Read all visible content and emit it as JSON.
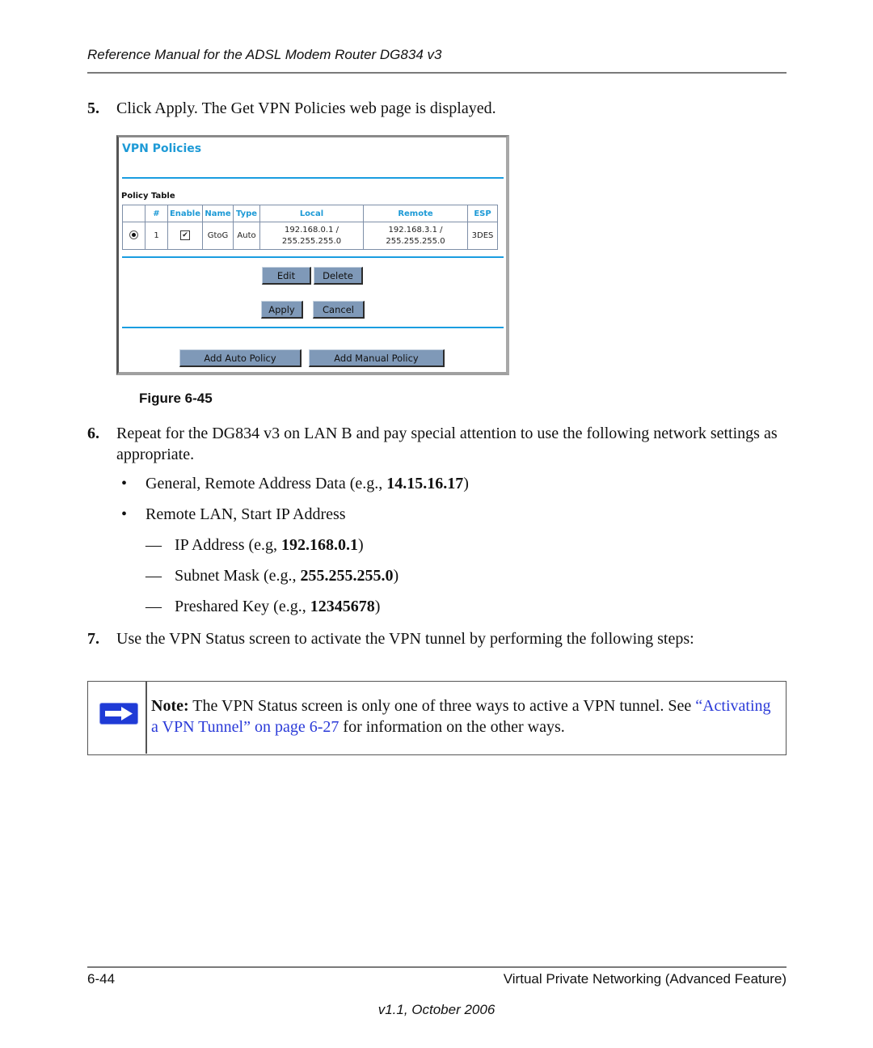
{
  "header": {
    "running_title": "Reference Manual for the ADSL Modem Router DG834 v3"
  },
  "step5": {
    "number": "5.",
    "text": "Click Apply. The Get VPN Policies web page is displayed."
  },
  "screenshot": {
    "title": "VPN Policies",
    "table_label": "Policy Table",
    "columns": [
      "",
      "#",
      "Enable",
      "Name",
      "Type",
      "Local",
      "Remote",
      "ESP"
    ],
    "rows": [
      {
        "selected": true,
        "num": "1",
        "enabled": true,
        "name": "GtoG",
        "type": "Auto",
        "local_ip": "192.168.0.1 /",
        "local_mask": "255.255.255.0",
        "remote_ip": "192.168.3.1 /",
        "remote_mask": "255.255.255.0",
        "esp": "3DES"
      }
    ],
    "buttons": {
      "edit": "Edit",
      "delete": "Delete",
      "apply": "Apply",
      "cancel": "Cancel",
      "add_auto": "Add Auto Policy",
      "add_manual": "Add Manual Policy"
    },
    "colors": {
      "accent": "#1d9ad6",
      "button": "#7f99b8"
    }
  },
  "figure": {
    "label": "Figure 6-45"
  },
  "step6": {
    "number": "6.",
    "text": "Repeat for the DG834 v3 on LAN B and pay special attention to use the following network settings as appropriate.",
    "bullets": [
      {
        "text": "General, Remote Address Data (e.g., ",
        "bold": "14.15.16.17",
        "end": ")"
      },
      {
        "text": "Remote LAN, Start IP Address"
      }
    ],
    "dash_items": [
      {
        "text": "IP Address (e.g, ",
        "bold": "192.168.0.1",
        "end": ")"
      },
      {
        "text": "Subnet Mask (e.g., ",
        "bold": "255.255.255.0",
        "end": ")"
      },
      {
        "text": "Preshared Key (e.g., ",
        "bold": "12345678",
        "end": ")"
      }
    ],
    "bullet_glyph": "•",
    "dash_glyph": "—"
  },
  "step7": {
    "number": "7.",
    "text": "Use the VPN Status screen to activate the VPN tunnel by performing the following steps:"
  },
  "note": {
    "icon": "right-arrow-icon",
    "label": "Note:",
    "text": " The VPN Status screen is only one of three ways to active a VPN tunnel. See ",
    "link": "“Activating a VPN Tunnel” on page 6-27",
    "tail": " for information on the other ways.",
    "link_color": "#2a3ad8"
  },
  "footer": {
    "page": "6-44",
    "section": "Virtual Private Networking (Advanced Feature)",
    "version": "v1.1, October 2006"
  }
}
